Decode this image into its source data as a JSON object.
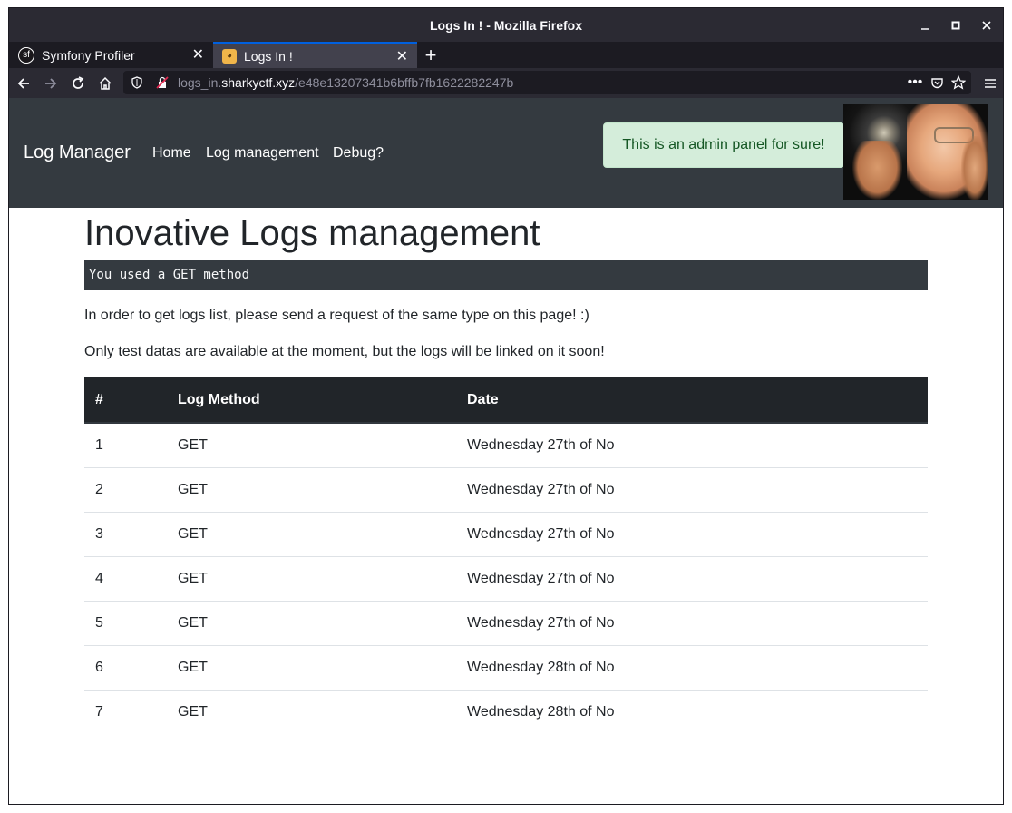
{
  "window": {
    "title": "Logs In ! - Mozilla Firefox",
    "controls": {
      "minimize": "–",
      "maximize": "□",
      "close": "✕"
    }
  },
  "tabs": [
    {
      "label": "Symfony Profiler",
      "icon": "symfony-icon",
      "active": false
    },
    {
      "label": "Logs In !",
      "icon": "cat-emoji-icon",
      "active": true
    }
  ],
  "toolbar": {
    "url_prefix": "logs_in.",
    "url_host": "sharkyctf.xyz",
    "url_path": "/e48e13207341b6bffb7fb1622282247b"
  },
  "app": {
    "brand": "Log Manager",
    "nav": [
      "Home",
      "Log management",
      "Debug?"
    ],
    "alert": "This is an admin panel for sure!"
  },
  "main": {
    "heading": "Inovative Logs management",
    "method_notice": "You used a GET method",
    "paragraph1": "In order to get logs list, please send a request of the same type on this page! :)",
    "paragraph2": "Only test datas are available at the moment, but the logs will be linked on it soon!"
  },
  "table": {
    "headers": [
      "#",
      "Log Method",
      "Date"
    ],
    "rows": [
      [
        "1",
        "GET",
        "Wednesday 27th of No"
      ],
      [
        "2",
        "GET",
        "Wednesday 27th of No"
      ],
      [
        "3",
        "GET",
        "Wednesday 27th of No"
      ],
      [
        "4",
        "GET",
        "Wednesday 27th of No"
      ],
      [
        "5",
        "GET",
        "Wednesday 27th of No"
      ],
      [
        "6",
        "GET",
        "Wednesday 28th of No"
      ],
      [
        "7",
        "GET",
        "Wednesday 28th of No"
      ]
    ]
  },
  "colors": {
    "navbar_bg": "#343a40",
    "alert_bg": "#d4edda",
    "alert_text": "#155724",
    "table_header_bg": "#212529",
    "firefox_chrome": "#2b2a33",
    "tab_accent": "#0060df"
  }
}
